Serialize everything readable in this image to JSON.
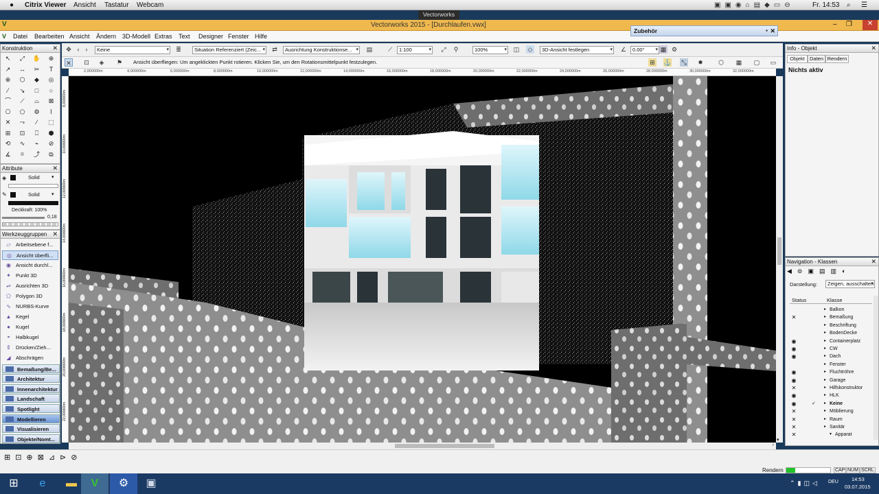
{
  "mac_menubar": {
    "apple": "",
    "items": [
      "Citrix Viewer",
      "Ansicht",
      "Tastatur",
      "Webcam"
    ],
    "clock": "Fr. 14:53"
  },
  "citrix_tab": "Vectorworks",
  "app_title": "Vectorworks 2015 - [Durchlaufen.vwx]",
  "menu": [
    "Datei",
    "Bearbeiten",
    "Ansicht",
    "Ändern",
    "3D-Modell",
    "Extras",
    "Text",
    "Designer",
    "Fenster",
    "Hilfe"
  ],
  "toolbar": {
    "layer_select": "Keine",
    "situation_select": "Situation Referenziert (Zeic...",
    "orientation_select": "Ausrichtung Konstruktionse...",
    "scale_value": "1:100",
    "zoom_value": "100%",
    "view_select": "3D-Ansicht festlegen",
    "angle_value": "0.00°",
    "hint_text": "Ansicht überfliegen: Um angeklickten Punkt rotieren. Klicken Sie, um den Rotationsmittelpunkt festzulegen."
  },
  "ruler_labels": [
    "2,000000m",
    "4,000000m",
    "6,000000m",
    "8,000000m",
    "10,000000m",
    "12,000000m",
    "14,000000m",
    "16,000000m",
    "18,000000m",
    "20,000000m",
    "22,000000m",
    "24,000000m",
    "26,000000m",
    "28,000000m",
    "30,000000m",
    "32,000000m"
  ],
  "vruler_labels": [
    "8,000000m",
    "10,000000m",
    "12,000000m",
    "14,000000m",
    "16,000000m",
    "18,000000m",
    "20,000000m",
    "22,000000m"
  ],
  "konstruktion_title": "Konstruktion",
  "attribute": {
    "title": "Attribute",
    "fill_label": "Solid",
    "pen_label": "Solid",
    "opacity": "Deckkraft: 100%",
    "thickness": "0,18"
  },
  "werkzeuggruppen": {
    "title": "Werkzeuggruppen",
    "tools": [
      "Arbeitsebene f...",
      "Ansicht überfli...",
      "Ansicht durchl...",
      "Punkt 3D",
      "Ausrichten 3D",
      "Polygon 3D",
      "NURBS-Kurve",
      "Kegel",
      "Kugel",
      "Halbkugel",
      "Drücken/Zieh...",
      "Abschrägen"
    ],
    "palettes": [
      "Bemaßung/Be...",
      "Architektur",
      "Innenarchitektur",
      "Landschaft",
      "Spotlight",
      "Modellieren",
      "Visualisieren",
      "Objekte/Nomt..."
    ]
  },
  "zubehoer_title": "Zubehör",
  "info": {
    "title": "Info - Objekt",
    "tabs": [
      "Objekt",
      "Daten",
      "Rendern"
    ],
    "status": "Nichts aktiv"
  },
  "navigation": {
    "title": "Navigation - Klassen",
    "darstellung_label": "Darstellung:",
    "darstellung_value": "Zeigen, ausschalten",
    "col_status": "Status",
    "col_klasse": "Klasse",
    "rows": [
      {
        "status": "",
        "name": "Balkon"
      },
      {
        "status": "×",
        "name": "Bemaßung"
      },
      {
        "status": "",
        "name": "Beschriftung"
      },
      {
        "status": "",
        "name": "BodenDecke"
      },
      {
        "status": "eye",
        "name": "Containerplatz"
      },
      {
        "status": "eye",
        "name": "CW"
      },
      {
        "status": "eye",
        "name": "Dach"
      },
      {
        "status": "",
        "name": "Fenster"
      },
      {
        "status": "eye",
        "name": "Fluchtröhre"
      },
      {
        "status": "eye",
        "name": "Garage"
      },
      {
        "status": "×",
        "name": "Hilfskonstruktor"
      },
      {
        "status": "eye",
        "name": "HLK"
      },
      {
        "status": "eye",
        "name": "Keine"
      },
      {
        "status": "×",
        "name": "Möblierung"
      },
      {
        "status": "×",
        "name": "Raum"
      },
      {
        "status": "×",
        "name": "Sanitär"
      },
      {
        "status": "×",
        "name": "Apparat"
      }
    ]
  },
  "statusbar": {
    "render_label": "Rendern",
    "caps": "CAP",
    "num": "NUM",
    "scrl": "SCRL"
  },
  "taskbar": {
    "time": "14:53",
    "date": "03.07.2015",
    "lang": "DEU"
  },
  "colors": {
    "title_bar": "#f0b94e",
    "taskbar": "#1b3a63",
    "viewport_bg": "#000000",
    "render_progress": "#22c22a"
  }
}
